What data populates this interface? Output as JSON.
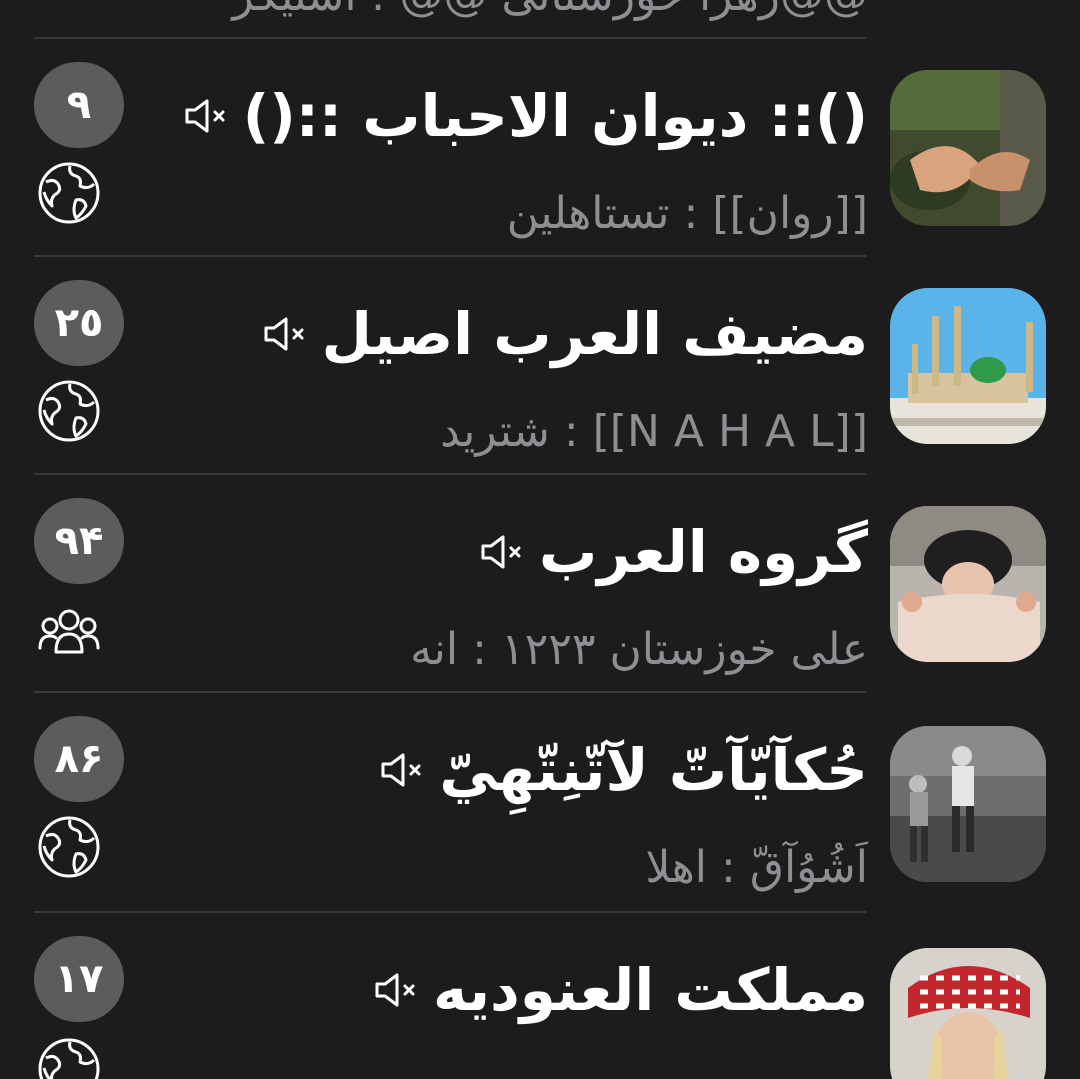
{
  "chat_list": {
    "partial_previous": {
      "subtitle": "@@زهرا خوزستانی @@ : استیکر"
    },
    "items": [
      {
        "title": "():: ديوان الاحباب ::()",
        "sender": "[[روان]]",
        "message": "تستاهلین",
        "badge": "٩",
        "type_icon": "globe-icon",
        "muted": true
      },
      {
        "title": "مضيف العرب اصيل",
        "sender": "[[N A H A L]]",
        "message": "شترید",
        "badge": "٢٥",
        "type_icon": "globe-icon",
        "muted": true
      },
      {
        "title": "گروه العرب",
        "sender": "علی خوزستان ١٢٢٣",
        "message": "انه",
        "badge": "٩۴",
        "type_icon": "group-icon",
        "muted": true
      },
      {
        "title": "حُكآيّآتّ لآتّنِتّهِيّ",
        "sender": "اَشُوُآقّ",
        "message": "اهلا",
        "badge": "٨۶",
        "type_icon": "globe-icon",
        "muted": true
      },
      {
        "title": "مملكت العنوديه",
        "sender": "",
        "message": "",
        "badge": "١٧",
        "type_icon": "globe-icon",
        "muted": true
      }
    ]
  },
  "colors": {
    "background": "#1c1c1d",
    "divider": "#3a3a3c",
    "badge": "#5c5c5e",
    "subtitle": "#8e8e93",
    "title": "#ffffff"
  }
}
